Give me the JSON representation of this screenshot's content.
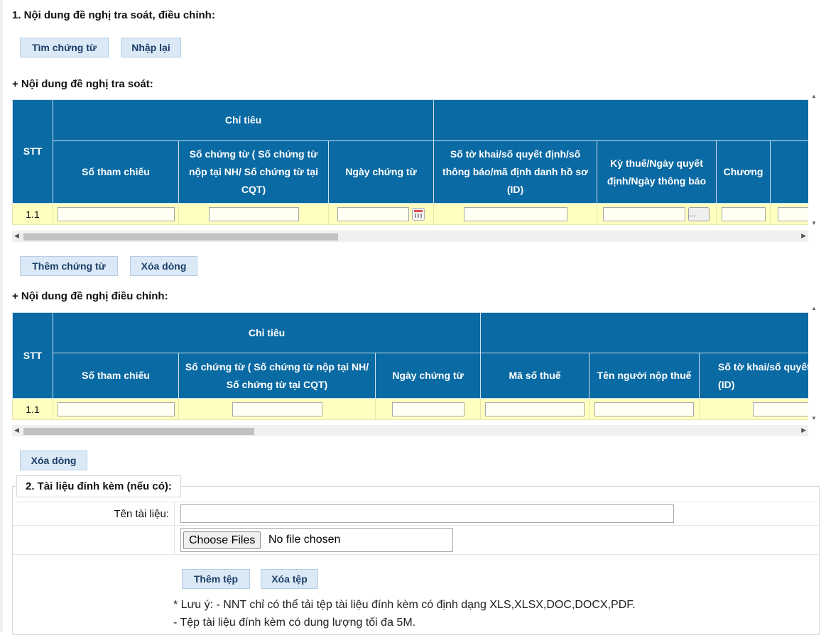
{
  "section1_title": "1. Nội dung đề nghị tra soát, điều chỉnh:",
  "buttons": {
    "find_voucher": "Tìm chứng từ",
    "reset": "Nhập lại",
    "add_voucher": "Thêm chứng từ",
    "delete_row": "Xóa dòng",
    "delete_row2": "Xóa dòng",
    "add_file": "Thêm tệp",
    "delete_file": "Xóa tệp"
  },
  "reconcile": {
    "title": "+ Nội dung đề nghị tra soát:",
    "headers": {
      "stt": "STT",
      "group": "Chỉ tiêu",
      "ref_no": "Số tham chiếu",
      "voucher_no": "Số chứng từ ( Số chứng từ nộp tại NH/ Số chứng từ tại CQT)",
      "voucher_date": "Ngày chứng từ",
      "decl_no": "Số tờ khai/số quyết định/số thông báo/mã định danh hồ sơ (ID)",
      "period": "Kỳ thuế/Ngày quyết định/Ngày thông báo",
      "chapter": "Chương"
    },
    "rows": [
      {
        "stt": "1.1"
      }
    ],
    "dots_label": "..."
  },
  "adjust": {
    "title": "+ Nội dung đề nghị điều chỉnh:",
    "headers": {
      "stt": "STT",
      "group": "Chỉ tiêu",
      "ref_no": "Số tham chiếu",
      "voucher_no": "Số chứng từ ( Số chứng từ nộp tại NH/ Số chứng từ tại CQT)",
      "voucher_date": "Ngày chứng từ",
      "tax_code": "Mã số thuế",
      "taxpayer": "Tên người nộp thuế",
      "decl_no": "Số tờ khai/số quyết định/số thông báo/mã định danh hồ sơ (ID)"
    },
    "rows": [
      {
        "stt": "1.1"
      }
    ]
  },
  "attachments": {
    "title": "2. Tài liệu đính kèm (nếu có):",
    "name_label": "Tên tài liệu:",
    "name_value": "",
    "choose_files": "Choose Files",
    "no_file": "No file chosen",
    "note1": "* Lưu ý: - NNT chỉ có thể tải tệp tài liệu đính kèm có định dạng XLS,XLSX,DOC,DOCX,PDF.",
    "note2": "- Tệp tài liệu đính kèm có dung lượng tối đa 5M."
  },
  "colors": {
    "header_bg": "#0a6aa3",
    "row_bg": "#ffffc0",
    "button_bg": "#dbe9f6"
  }
}
